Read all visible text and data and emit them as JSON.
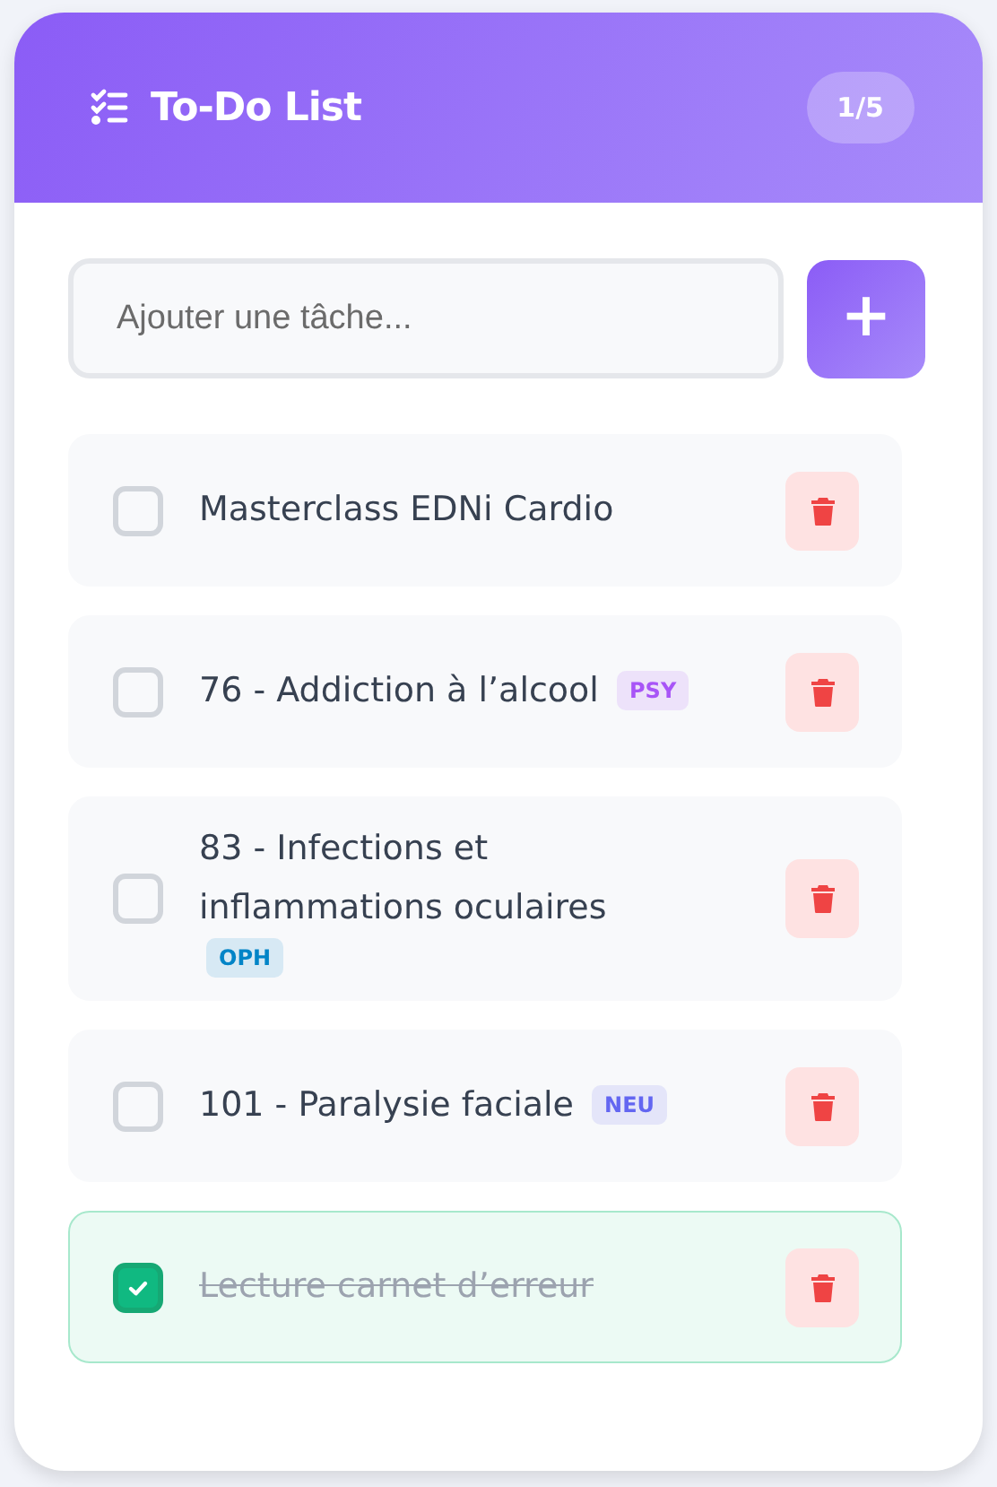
{
  "header": {
    "title": "To-Do List",
    "counter": "1/5"
  },
  "new_task": {
    "placeholder": "Ajouter une tâche...",
    "add_button": "+"
  },
  "tasks": [
    {
      "text": "Masterclass EDNi Cardio",
      "checked": false
    },
    {
      "text": "76 - Addiction à l’alcool",
      "checked": false,
      "tag": {
        "label": "PSY",
        "color": "#a855f7"
      }
    },
    {
      "text": "83 - Infections et inflammations oculaires",
      "checked": false,
      "tag": {
        "label": "OPH",
        "color": "#0284c7"
      }
    },
    {
      "text": "101 - Paralysie faciale",
      "checked": false,
      "tag": {
        "label": "NEU",
        "color": "#6366f1"
      }
    },
    {
      "text": "Lecture carnet d’erreur",
      "checked": true
    }
  ]
}
